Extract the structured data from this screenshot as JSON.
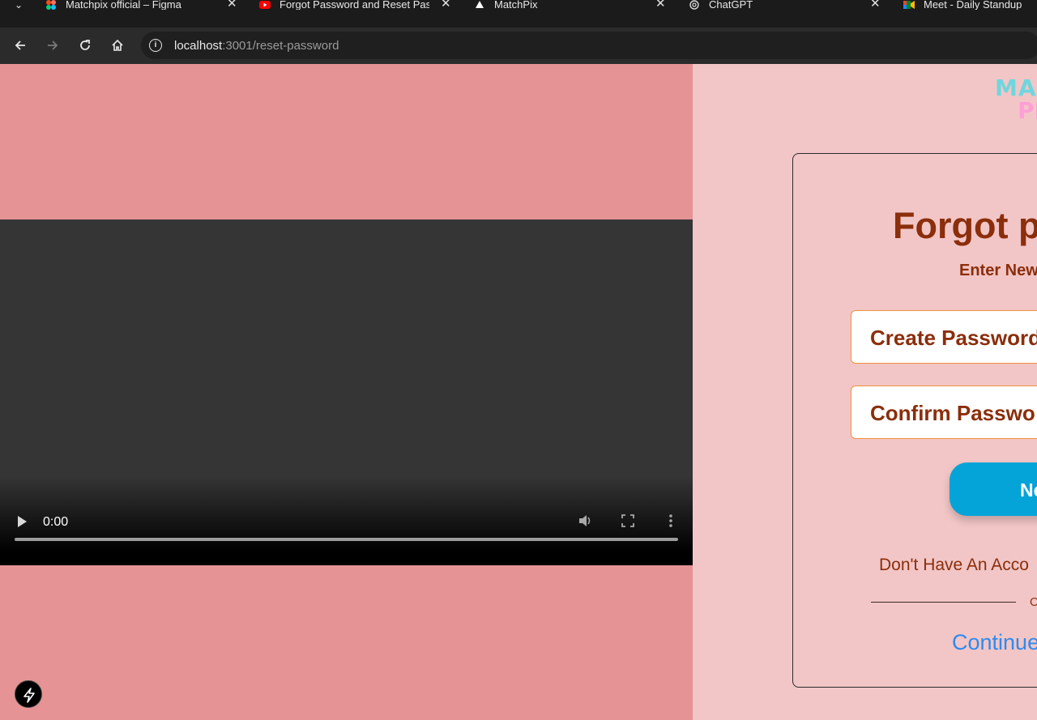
{
  "browser": {
    "tabs": [
      {
        "title": "Matchpix official – Figma",
        "icon": "figma-icon"
      },
      {
        "title": "Forgot Password and Reset Pas",
        "icon": "youtube-icon"
      },
      {
        "title": "MatchPix",
        "icon": "triangle-icon"
      },
      {
        "title": "ChatGPT",
        "icon": "chatgpt-icon"
      },
      {
        "title": "Meet - Daily Standup",
        "icon": "google-meet-icon"
      }
    ],
    "close_glyph": "✕",
    "url_host": "localhost",
    "url_rest": ":3001/reset-password"
  },
  "video": {
    "time": "0:00",
    "progress": 0
  },
  "auth": {
    "logo_line1": "MA",
    "logo_line2": "PI",
    "title": "Forgot p",
    "subtitle": "Enter New",
    "create_password_placeholder": "Create Password",
    "confirm_password_placeholder": "Confirm Passwo",
    "submit_label": "Ne",
    "no_account_text": "Don't Have An Acco",
    "or_text": "O",
    "continue_text": "Continue"
  },
  "colors": {
    "left_bg": "#e59394",
    "right_bg": "#f2c6c6",
    "brand_brown": "#8b2e0b",
    "button_blue": "#05a4d8",
    "link_blue": "#2f8aef",
    "field_border": "#f0913f"
  }
}
